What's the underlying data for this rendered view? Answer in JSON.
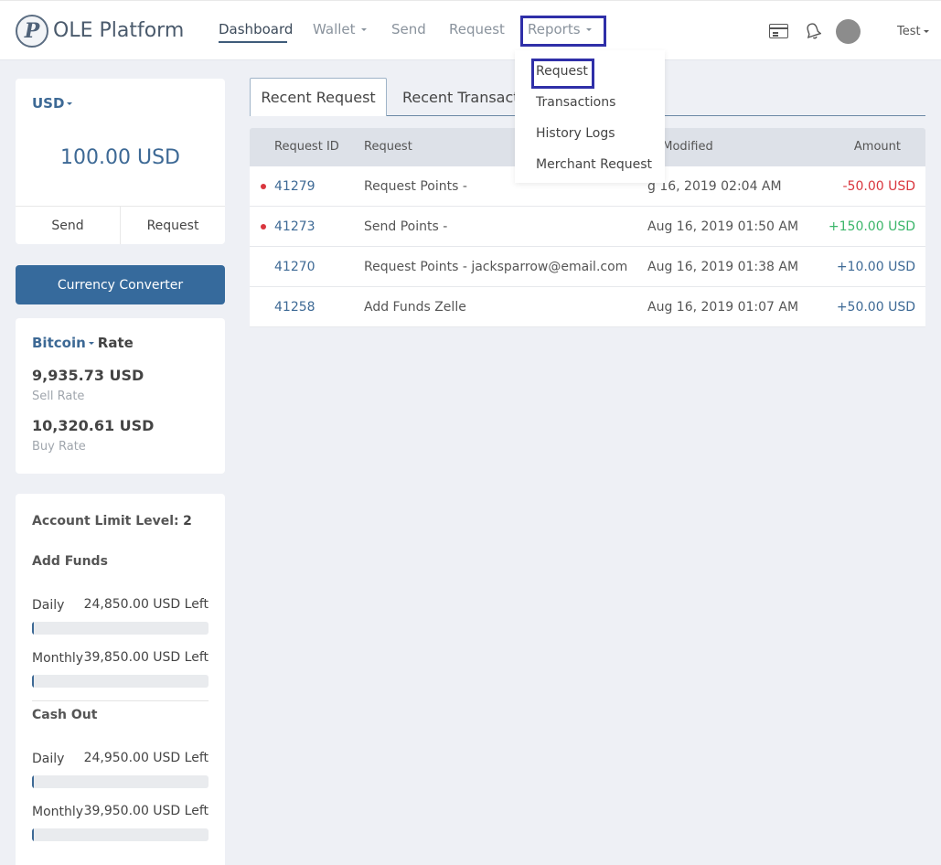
{
  "brand": {
    "name": "OLE Platform",
    "logo_letter": "P"
  },
  "nav": {
    "dashboard": "Dashboard",
    "wallet": "Wallet",
    "send": "Send",
    "request": "Request",
    "reports": "Reports"
  },
  "header": {
    "user": "Test"
  },
  "reports_menu": {
    "items": [
      "Request",
      "Transactions",
      "History Logs",
      "Merchant Request"
    ]
  },
  "balance": {
    "currency": "USD",
    "amount": "100.00 USD",
    "send_label": "Send",
    "request_label": "Request"
  },
  "converter_label": "Currency Converter",
  "rate": {
    "coin": "Bitcoin",
    "title_suffix": "Rate",
    "sell_value": "9,935.73 USD",
    "sell_label": "Sell Rate",
    "buy_value": "10,320.61 USD",
    "buy_label": "Buy Rate"
  },
  "limits": {
    "level_label": "Account Limit Level:",
    "level": "2",
    "add_funds": {
      "title": "Add Funds",
      "daily_label": "Daily",
      "daily_left": "24,850.00 USD Left",
      "daily_used_fraction": 0.006,
      "monthly_label": "Monthly",
      "monthly_left": "39,850.00 USD Left",
      "monthly_used_fraction": 0.004
    },
    "cash_out": {
      "title": "Cash Out",
      "daily_label": "Daily",
      "daily_left": "24,950.00 USD Left",
      "daily_used_fraction": 0.002,
      "monthly_label": "Monthly",
      "monthly_left": "39,950.00 USD Left",
      "monthly_used_fraction": 0.001
    }
  },
  "tabs": {
    "recent_request": "Recent Request",
    "recent_transactions": "Recent Transactio"
  },
  "table": {
    "headers": {
      "id": "Request ID",
      "request": "Request",
      "modified": "t Modified",
      "amount": "Amount"
    },
    "rows": [
      {
        "id": "41279",
        "request": "Request Points -",
        "modified": "g 16, 2019 02:04 AM",
        "amount": "-50.00 USD",
        "status": "negative",
        "unread": true
      },
      {
        "id": "41273",
        "request": "Send Points -",
        "modified": "Aug 16, 2019 01:50 AM",
        "amount": "+150.00 USD",
        "status": "positive",
        "unread": true
      },
      {
        "id": "41270",
        "request": "Request Points - jacksparrow@email.com",
        "modified": "Aug 16, 2019 01:38 AM",
        "amount": "+10.00 USD",
        "status": "neutral",
        "unread": false
      },
      {
        "id": "41258",
        "request": "Add Funds Zelle",
        "modified": "Aug 16, 2019 01:07 AM",
        "amount": "+50.00 USD",
        "status": "neutral",
        "unread": false
      }
    ]
  },
  "colors": {
    "negative": "#d9363e",
    "positive": "#3bb56a",
    "neutral": "#3d6995"
  }
}
